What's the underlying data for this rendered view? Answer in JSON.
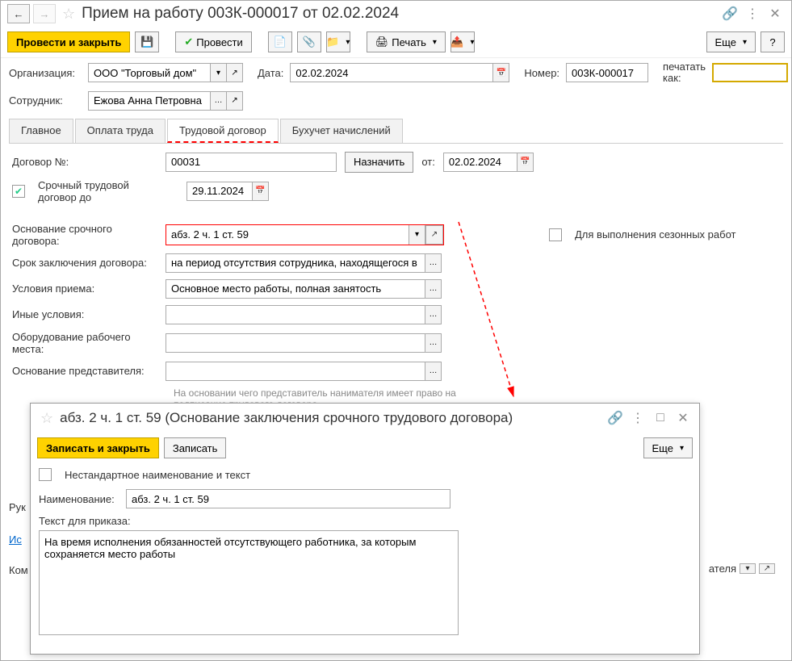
{
  "header": {
    "title": "Прием на работу 003К-000017 от 02.02.2024"
  },
  "toolbar": {
    "post_close": "Провести и закрыть",
    "post": "Провести",
    "print": "Печать",
    "more": "Еще",
    "help": "?"
  },
  "row1": {
    "org_label": "Организация:",
    "org_value": "ООО \"Торговый дом\"",
    "date_label": "Дата:",
    "date_value": "02.02.2024",
    "number_label": "Номер:",
    "number_value": "003К-000017",
    "print_as_label": "печатать как:",
    "print_as_value": ""
  },
  "row2": {
    "emp_label": "Сотрудник:",
    "emp_value": "Ежова Анна Петровна"
  },
  "tabs": {
    "main": "Главное",
    "pay": "Оплата труда",
    "contract": "Трудовой договор",
    "acc": "Бухучет начислений"
  },
  "contract": {
    "num_label": "Договор №:",
    "num_value": "00031",
    "assign": "Назначить",
    "from_label": "от:",
    "from_value": "02.02.2024",
    "fixed_term_label": "Срочный трудовой договор до",
    "fixed_term_value": "29.11.2024",
    "basis_label": "Основание срочного договора:",
    "basis_value": "абз. 2 ч. 1 ст. 59",
    "seasonal_label": "Для выполнения сезонных работ",
    "term_label": "Срок заключения договора:",
    "term_value": "на период отсутствия сотрудника, находящегося в декрете",
    "conditions_label": "Условия приема:",
    "conditions_value": "Основное место работы, полная занятость",
    "other_label": "Иные условия:",
    "other_value": "",
    "equipment_label": "Оборудование рабочего места:",
    "equipment_value": "",
    "rep_basis_label": "Основание представителя:",
    "rep_basis_value": "",
    "rep_hint": "На основании чего представитель нанимателя имеет право на подписание трудового договора"
  },
  "popup": {
    "title": "абз. 2 ч. 1 ст. 59 (Основание заключения срочного трудового договора)",
    "save_close": "Записать и закрыть",
    "save": "Записать",
    "more": "Еще",
    "nonstandard_label": "Нестандартное наименование и текст",
    "name_label": "Наименование:",
    "name_value": "абз. 2 ч. 1 ст. 59",
    "order_text_label": "Текст для приказа:",
    "order_text_value": "На время исполнения обязанностей отсутствующего работника, за которым сохраняется место работы"
  },
  "bottom": {
    "ruk": "Рук",
    "isp": "Ис",
    "kom": "Ком",
    "ateля": "ателя"
  }
}
